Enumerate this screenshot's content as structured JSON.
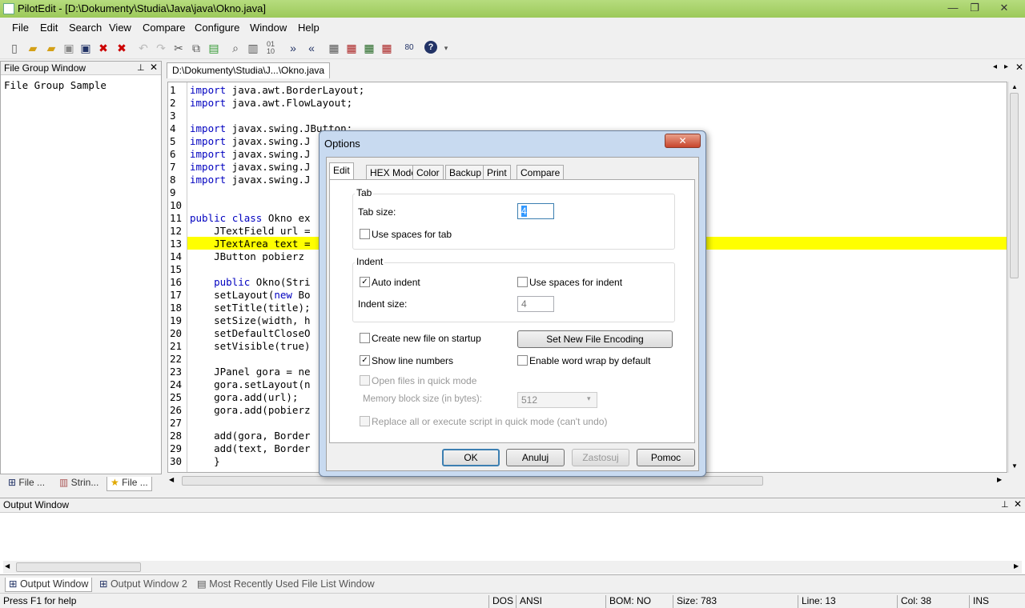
{
  "window": {
    "title": "PilotEdit - [D:\\Dokumenty\\Studia\\Java\\java\\Okno.java]",
    "min": "—",
    "max": "❐",
    "close": "✕"
  },
  "menu": [
    "File",
    "Edit",
    "Search",
    "View",
    "Compare",
    "Configure",
    "Window",
    "Help"
  ],
  "left_panel": {
    "title": "File Group Window",
    "item": "File Group Sample",
    "tabs": [
      "File ...",
      "Strin...",
      "File ..."
    ]
  },
  "doc_tab": "D:\\Dokumenty\\Studia\\J...\\Okno.java",
  "code": [
    "import java.awt.BorderLayout;",
    "import java.awt.FlowLayout;",
    "",
    "import javax.swing.JButton;",
    "import javax.swing.J",
    "import javax.swing.J",
    "import javax.swing.J",
    "import javax.swing.J",
    "",
    "",
    "public class Okno ex",
    "    JTextField url =",
    "    JTextArea text =",
    "    JButton pobierz ",
    "",
    "    public Okno(Stri",
    "    setLayout(new Bo",
    "    setTitle(title);",
    "    setSize(width, h",
    "    setDefaultCloseO",
    "    setVisible(true)",
    "",
    "    JPanel gora = ne",
    "    gora.setLayout(n",
    "    gora.add(url);",
    "    gora.add(pobierz",
    "",
    "    add(gora, Border",
    "    add(text, Border",
    "    }"
  ],
  "output": {
    "title": "Output Window",
    "tabs": [
      "Output Window",
      "Output Window 2",
      "Most Recently Used File List Window"
    ]
  },
  "status": {
    "help": "Press F1 for help",
    "eol": "DOS",
    "enc": "ANSI",
    "bom": "BOM: NO",
    "size": "Size: 783",
    "line": "Line: 13",
    "col": "Col: 38",
    "mode": "INS"
  },
  "dialog": {
    "title": "Options",
    "close": "✕",
    "tabs": [
      "Edit",
      "HEX Mode",
      "Color",
      "Backup",
      "Print",
      "Compare"
    ],
    "tab_group": "Tab",
    "tab_size_label": "Tab size:",
    "tab_size": "4",
    "use_spaces_tab": "Use spaces for tab",
    "indent_group": "Indent",
    "auto_indent": "Auto indent",
    "use_spaces_indent": "Use spaces for indent",
    "indent_size_label": "Indent size:",
    "indent_size": "4",
    "create_new": "Create new file on startup",
    "set_encoding": "Set New File Encoding",
    "show_line_numbers": "Show line numbers",
    "word_wrap": "Enable word wrap by default",
    "quick_mode": "Open files in quick mode",
    "memory_label": "Memory block size (in bytes):",
    "memory_value": "512",
    "replace_all": "Replace all or execute script in quick mode (can't undo)",
    "ok": "OK",
    "cancel": "Anuluj",
    "apply": "Zastosuj",
    "help": "Pomoc"
  }
}
